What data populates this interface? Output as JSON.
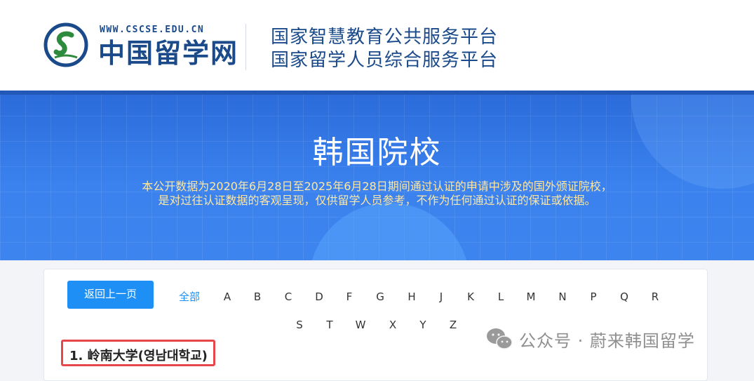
{
  "header": {
    "logo_url": "WWW.CSCSE.EDU.CN",
    "logo_name": "中国留学网",
    "platform_line1": "国家智慧教育公共服务平台",
    "platform_line2": "国家留学人员综合服务平台"
  },
  "banner": {
    "title": "韩国院校",
    "subtitle_line1": "本公开数据为2020年6月28日至2025年6月28日期间通过认证的申请中涉及的国外颁证院校，",
    "subtitle_line2": "是对过往认证数据的客观呈现，仅供留学人员参考，不作为任何通过认证的保证或依据。"
  },
  "nav": {
    "back_label": "返回上一页",
    "all_label": "全部",
    "letters_row1": [
      "A",
      "B",
      "C",
      "D",
      "F",
      "G",
      "H",
      "J",
      "K",
      "L",
      "M",
      "N",
      "P",
      "Q",
      "R"
    ],
    "letters_row2": [
      "S",
      "T",
      "W",
      "X",
      "Y",
      "Z"
    ]
  },
  "list": {
    "item1": "1.  岭南大学(영남대학교)"
  },
  "watermark": {
    "icon": "wechat-icon",
    "text": "公众号 · 蔚来韩国留学"
  },
  "colors": {
    "brand_blue": "#1a4a8a",
    "button_blue": "#1e90f5",
    "highlight_red": "#e6474b",
    "subtitle_yellow": "#ffe7a3"
  }
}
